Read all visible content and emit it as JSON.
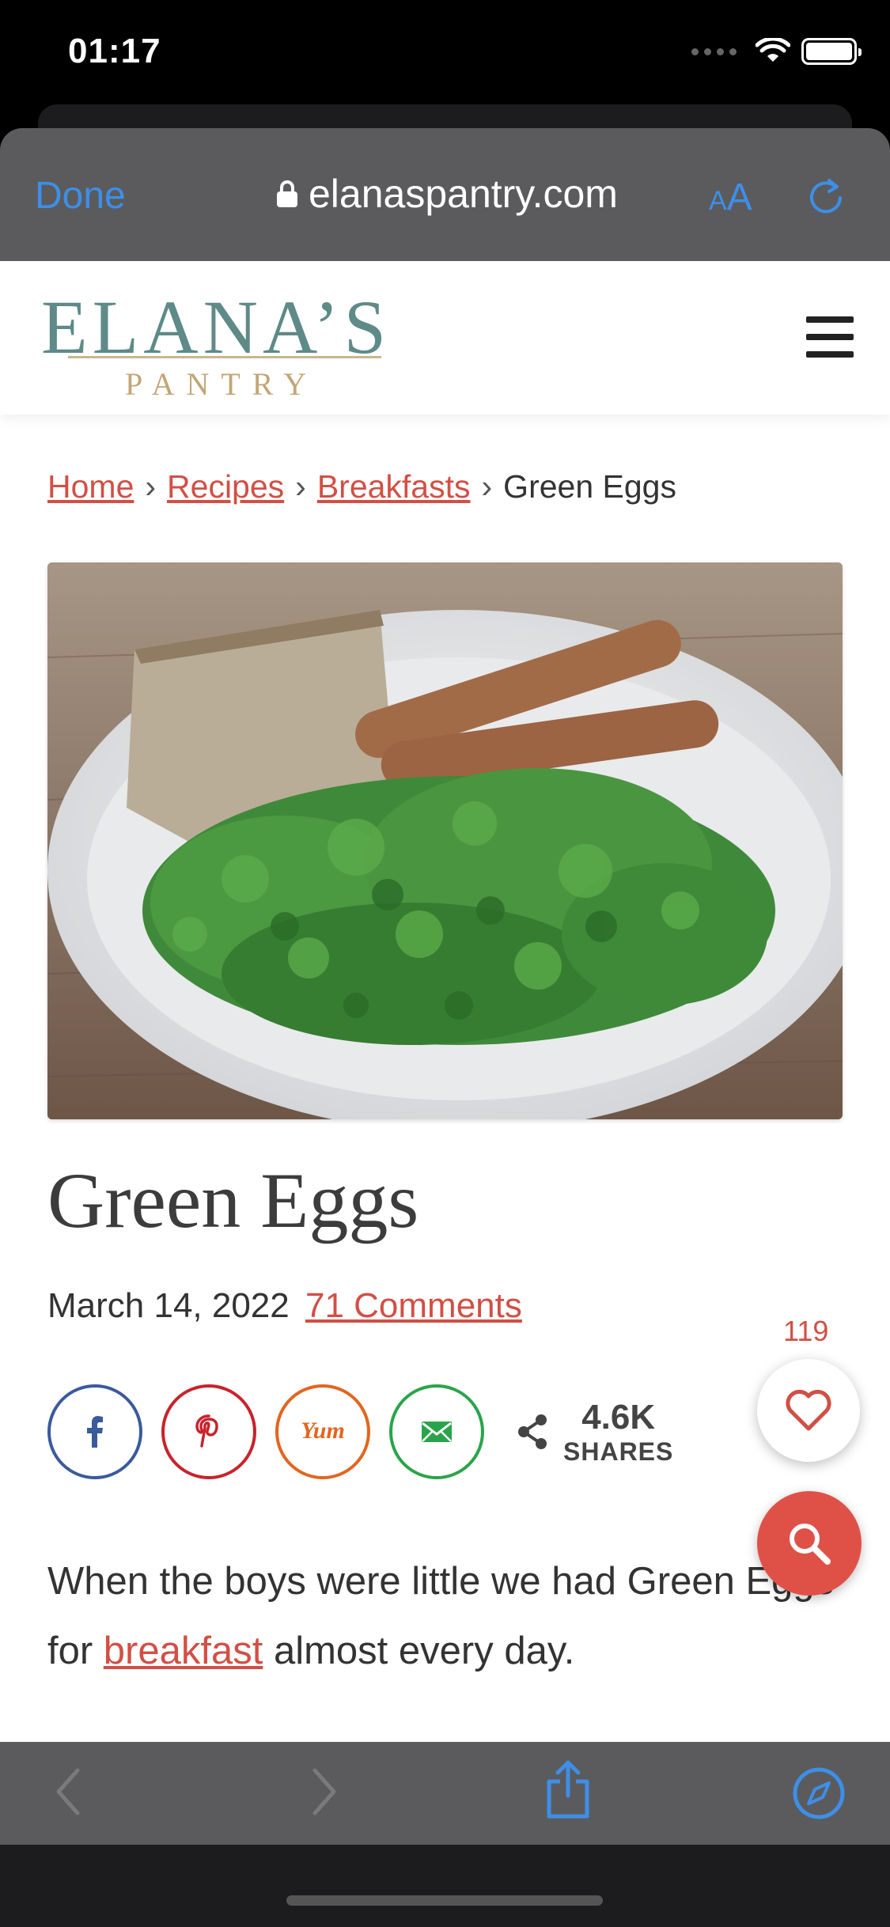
{
  "status_bar": {
    "time": "01:17"
  },
  "browser": {
    "done_label": "Done",
    "url": "elanaspantry.com",
    "text_size_small": "A",
    "text_size_large": "A"
  },
  "site": {
    "logo_main": "ELANA’S",
    "logo_sub": "PANTRY"
  },
  "breadcrumb": {
    "items": [
      "Home",
      "Recipes",
      "Breakfasts"
    ],
    "current": "Green Eggs",
    "separator": "›"
  },
  "post": {
    "title": "Green Eggs",
    "date": "March 14, 2022",
    "comments": "71 Comments"
  },
  "share": {
    "total_count": "4.6K",
    "total_label": "SHARES"
  },
  "intro": {
    "before": "When the boys were little we had Green Eggs for ",
    "link": "breakfast",
    "after": " almost every day."
  },
  "favorites": {
    "count": "119"
  },
  "colors": {
    "accent_link": "#d24f45",
    "ios_blue": "#3d8fe8",
    "logo_teal": "#5e8a88",
    "logo_gold": "#c2a676",
    "facebook": "#3b5a9d",
    "pinterest": "#c8232c",
    "yummly": "#e2661f",
    "email": "#2aa44a"
  }
}
